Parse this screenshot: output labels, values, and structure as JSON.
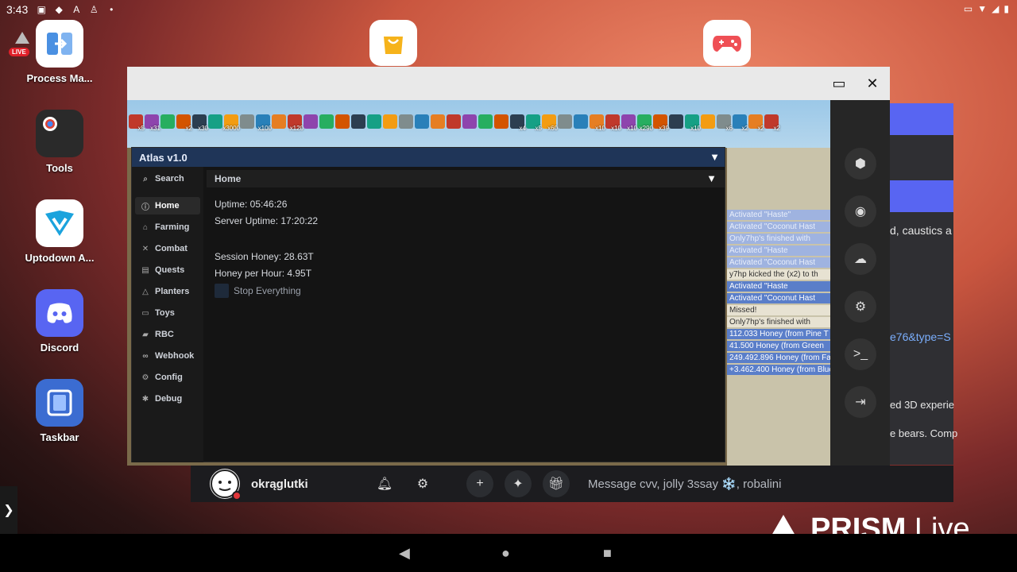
{
  "statusbar": {
    "time": "3:43"
  },
  "desktop": {
    "icons": [
      {
        "label": "Process Ma..."
      },
      {
        "label": "Tools"
      },
      {
        "label": "Uptodown A..."
      },
      {
        "label": "Discord"
      },
      {
        "label": "Taskbar"
      }
    ],
    "live_badge": "LIVE"
  },
  "atlas": {
    "title": "Atlas v1.0",
    "nav": [
      {
        "label": "Search",
        "icon": "search-icon"
      },
      {
        "label": "Home",
        "icon": "info-icon"
      },
      {
        "label": "Farming",
        "icon": "home-icon"
      },
      {
        "label": "Combat",
        "icon": "swords-icon"
      },
      {
        "label": "Quests",
        "icon": "clipboard-icon"
      },
      {
        "label": "Planters",
        "icon": "sprout-icon"
      },
      {
        "label": "Toys",
        "icon": "box-icon"
      },
      {
        "label": "RBC",
        "icon": "shield-icon"
      },
      {
        "label": "Webhook",
        "icon": "link-icon"
      },
      {
        "label": "Config",
        "icon": "gear-icon"
      },
      {
        "label": "Debug",
        "icon": "bug-icon"
      }
    ],
    "section_title": "Home",
    "uptime": "Uptime: 05:46:26",
    "server_uptime": "Server Uptime: 17:20:22",
    "session_honey": "Session Honey: 28.63T",
    "honey_per_hour": "Honey per Hour: 4.95T",
    "stop_label": "Stop Everything"
  },
  "chatlog": [
    {
      "text": "Activated \"Haste\"",
      "style": "light"
    },
    {
      "text": "Activated \"Coconut Hast",
      "style": "light"
    },
    {
      "text": "Only7hp's finished with",
      "style": "light"
    },
    {
      "text": "Activated \"Haste",
      "style": "light"
    },
    {
      "text": "Activated \"Coconut Hast",
      "style": "light"
    },
    {
      "text": "y7hp kicked the (x2) to th",
      "style": "white"
    },
    {
      "text": "Activated \"Haste",
      "style": "blue"
    },
    {
      "text": "Activated \"Coconut Hast",
      "style": "blue"
    },
    {
      "text": "Missed!",
      "style": "white"
    },
    {
      "text": "Only7hp's finished with",
      "style": "white"
    },
    {
      "text": "112.033 Honey (from Pine T",
      "style": "blue"
    },
    {
      "text": "41.500 Honey (from Green",
      "style": "blue"
    },
    {
      "text": "249.492.896 Honey (from Fa",
      "style": "blue"
    },
    {
      "text": "+3.462.400 Honey (from Blue",
      "style": "blue"
    }
  ],
  "buff_counts": [
    "x5",
    "x31",
    "",
    "x2",
    "x30",
    "",
    "x3000",
    "",
    "x100",
    "",
    "x120",
    "",
    "",
    "",
    "",
    "",
    "",
    "",
    "",
    "",
    "",
    "",
    "",
    "",
    "x4",
    "x5",
    "x60",
    "",
    "",
    "x10",
    "x10",
    "x10",
    "x290",
    "x39",
    "",
    "x10",
    "",
    "x6",
    "x2",
    "x2",
    "x2"
  ],
  "discord": {
    "username": "okrąglutki",
    "message_placeholder": "Message cvv, jolly 3ssay ❄️, robalini"
  },
  "behind_text": {
    "t1": "d, caustics a",
    "t2": "e76&type=S",
    "t3": "ed 3D experie",
    "t4": "e bears. Comp"
  },
  "prism": {
    "bold": "PRISM",
    "light": "Live"
  },
  "colors": {
    "atlas_header": "#1f3558",
    "discord_blurple": "#5865f2"
  }
}
